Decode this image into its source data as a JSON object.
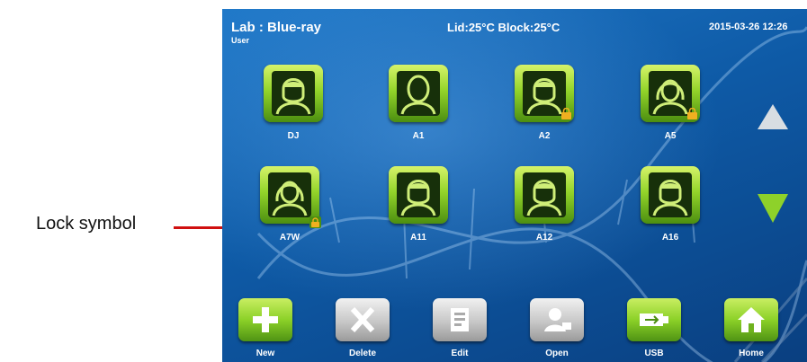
{
  "callout": {
    "label": "Lock symbol"
  },
  "header": {
    "title": "Lab : Blue-ray",
    "subtitle": "User",
    "temps": "Lid:25°C   Block:25°C",
    "datetime": "2015-03-26 12:26"
  },
  "users": [
    {
      "name": "DJ",
      "avatar": "male-user-icon",
      "locked": false
    },
    {
      "name": "A1",
      "avatar": "bald-user-icon",
      "locked": false
    },
    {
      "name": "A2",
      "avatar": "male-user-icon",
      "locked": true
    },
    {
      "name": "A5",
      "avatar": "female-user-icon",
      "locked": true
    },
    {
      "name": "A7W",
      "avatar": "female-user-icon",
      "locked": true
    },
    {
      "name": "A11",
      "avatar": "male-user-icon",
      "locked": false
    },
    {
      "name": "A12",
      "avatar": "male-user-icon",
      "locked": false
    },
    {
      "name": "A16",
      "avatar": "male-user-icon",
      "locked": false
    }
  ],
  "toolbar": [
    {
      "label": "New",
      "icon": "plus-icon",
      "style": "green"
    },
    {
      "label": "Delete",
      "icon": "x-icon",
      "style": "gray"
    },
    {
      "label": "Edit",
      "icon": "edit-icon",
      "style": "gray"
    },
    {
      "label": "Open",
      "icon": "open-user-icon",
      "style": "gray"
    },
    {
      "label": "USB",
      "icon": "usb-icon",
      "style": "green"
    },
    {
      "label": "Home",
      "icon": "home-icon",
      "style": "green"
    }
  ],
  "colors": {
    "accent_green": "#8ed12a",
    "screen_blue": "#0e5aa6",
    "callout_red": "#d01010"
  }
}
